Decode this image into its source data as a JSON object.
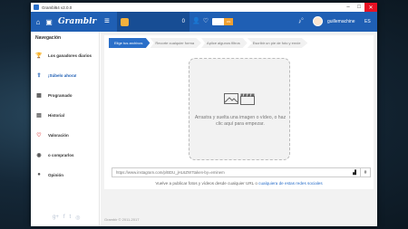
{
  "window": {
    "title": "Grambl64 v2.0.0",
    "minimize": "–",
    "maximize": "□",
    "close": "✕"
  },
  "topbar": {
    "brand": "Gramblr",
    "coins": "0",
    "toggle_label": "ON",
    "notifications": "0",
    "username": "guillemachine",
    "language": "ES"
  },
  "sidebar": {
    "heading": "Navegación",
    "items": [
      {
        "label": "Los ganadores diarios",
        "icon": "trophy-icon",
        "glyph": "🏆"
      },
      {
        "label": "¡Súbelo ahora!",
        "icon": "upload-icon",
        "glyph": "⇧"
      },
      {
        "label": "Programado",
        "icon": "calendar-icon",
        "glyph": "▦"
      },
      {
        "label": "Historial",
        "icon": "history-icon",
        "glyph": "▤"
      },
      {
        "label": "Valoración",
        "icon": "heart-icon",
        "glyph": "♡"
      },
      {
        "label": "o comprarlos",
        "icon": "cart-icon",
        "glyph": "◉"
      },
      {
        "label": "Opinión",
        "icon": "chat-icon",
        "glyph": "●"
      }
    ],
    "social": [
      "g+",
      "f",
      "t",
      "◎"
    ]
  },
  "steps": [
    "Elige tus archivos",
    "Recorte cualquier forma",
    "Aplice algunos filtros",
    "Escribir un pie de foto y envíe"
  ],
  "dropzone": {
    "text": "Arrastra y suelta una imagen o vídeo, o haz clic aquí para empezar."
  },
  "url": {
    "placeholder": "https://www.instagram.com/p/BDU_jHL6ZW7taken-by=eminem",
    "hash": "#"
  },
  "hint": {
    "prefix": "Vuelve a publicar fotos y vídeos desde cualquier URL o ",
    "link": "cualquiera de estas redes sociales"
  },
  "footer": "Gramblr © 2011-2017",
  "colors": {
    "brand_blue": "#1f5fb4",
    "accent_orange": "#f0a030"
  }
}
